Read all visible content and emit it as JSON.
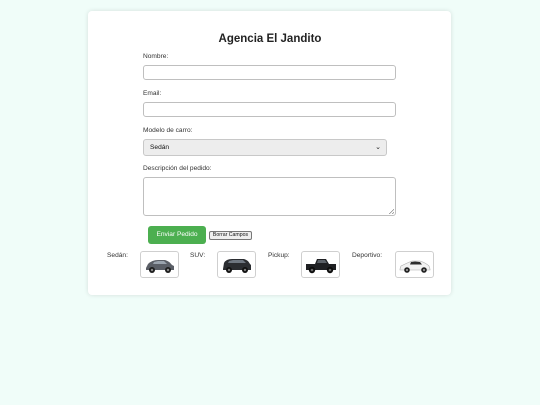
{
  "form": {
    "title": "Agencia El Jandito",
    "name_label": "Nombre:",
    "email_label": "Email:",
    "model_label": "Modelo de carro:",
    "model_selected": "Sedán",
    "description_label": "Descripción del pedido:",
    "submit_label": "Enviar Pedido",
    "clear_label": "Borrar Campos"
  },
  "cars": [
    {
      "label": "Sedán:",
      "icon": "sedan-car-icon",
      "color": "#5a5e66"
    },
    {
      "label": "SUV:",
      "icon": "suv-car-icon",
      "color": "#2b2d31"
    },
    {
      "label": "Pickup:",
      "icon": "pickup-truck-icon",
      "color": "#1f2023"
    },
    {
      "label": "Deportivo:",
      "icon": "sports-car-icon",
      "color": "#f2f2f2"
    }
  ],
  "colors": {
    "background": "#f0fdf9",
    "accent": "#4caf50"
  }
}
